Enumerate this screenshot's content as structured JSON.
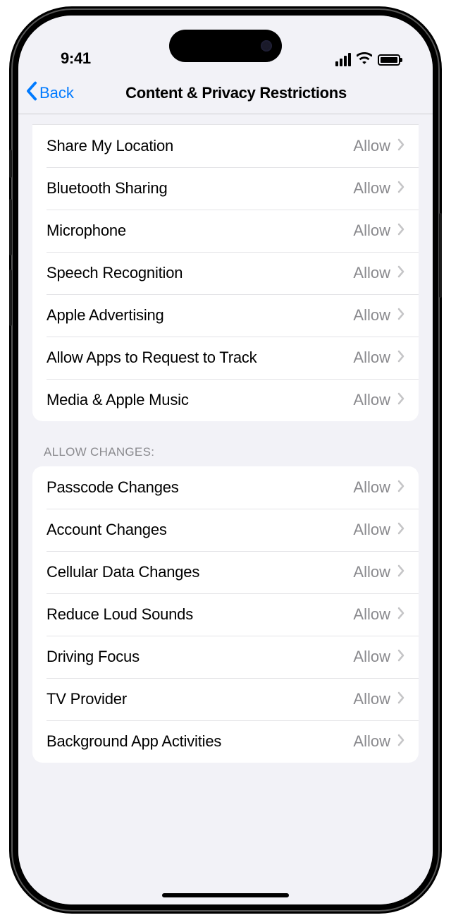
{
  "status": {
    "time": "9:41"
  },
  "nav": {
    "back_label": "Back",
    "title": "Content & Privacy Restrictions"
  },
  "group1": {
    "items": [
      {
        "label": "Share My Location",
        "value": "Allow"
      },
      {
        "label": "Bluetooth Sharing",
        "value": "Allow"
      },
      {
        "label": "Microphone",
        "value": "Allow"
      },
      {
        "label": "Speech Recognition",
        "value": "Allow"
      },
      {
        "label": "Apple Advertising",
        "value": "Allow"
      },
      {
        "label": "Allow Apps to Request to Track",
        "value": "Allow"
      },
      {
        "label": "Media & Apple Music",
        "value": "Allow"
      }
    ]
  },
  "group2": {
    "header": "Allow Changes:",
    "items": [
      {
        "label": "Passcode Changes",
        "value": "Allow"
      },
      {
        "label": "Account Changes",
        "value": "Allow"
      },
      {
        "label": "Cellular Data Changes",
        "value": "Allow"
      },
      {
        "label": "Reduce Loud Sounds",
        "value": "Allow"
      },
      {
        "label": "Driving Focus",
        "value": "Allow"
      },
      {
        "label": "TV Provider",
        "value": "Allow"
      },
      {
        "label": "Background App Activities",
        "value": "Allow"
      }
    ]
  }
}
